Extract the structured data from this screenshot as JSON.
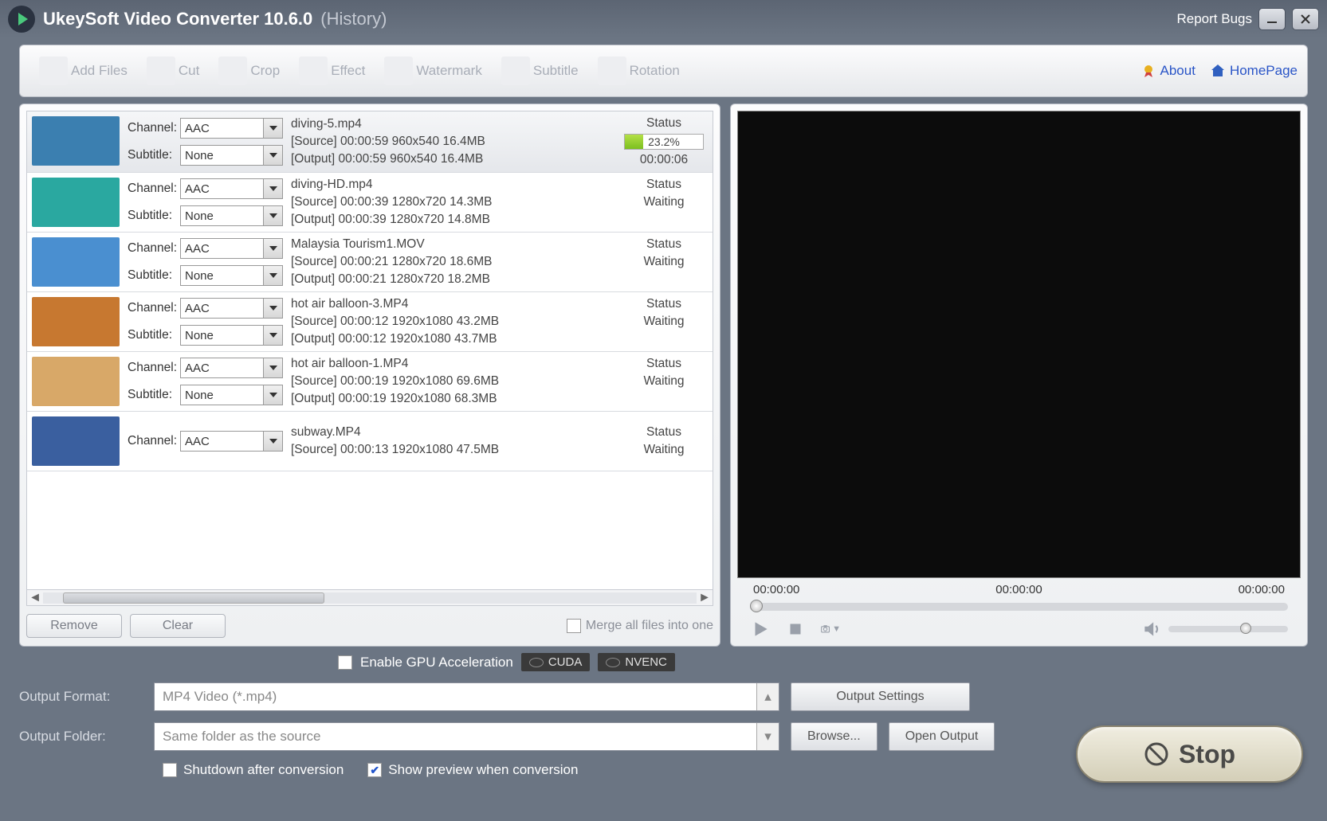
{
  "titlebar": {
    "app": "UkeySoft Video Converter 10.6.0",
    "suffix": "(History)",
    "report": "Report Bugs"
  },
  "toolbar": {
    "items": [
      "Add Files",
      "Cut",
      "Crop",
      "Effect",
      "Watermark",
      "Subtitle",
      "Rotation"
    ],
    "about": "About",
    "homepage": "HomePage"
  },
  "labels": {
    "channel": "Channel:",
    "subtitle": "Subtitle:",
    "status": "Status",
    "waiting": "Waiting"
  },
  "files": [
    {
      "name": "diving-5.mp4",
      "channel": "AAC",
      "subtitle": "None",
      "source": "[Source]  00:00:59  960x540  16.4MB",
      "output": "[Output]  00:00:59  960x540  16.4MB",
      "progress": "23.2%",
      "elapsed": "00:00:06",
      "active": true,
      "thumb": "#3b7fb0"
    },
    {
      "name": "diving-HD.mp4",
      "channel": "AAC",
      "subtitle": "None",
      "source": "[Source]  00:00:39  1280x720  14.3MB",
      "output": "[Output]  00:00:39  1280x720  14.8MB",
      "thumb": "#2aa8a0"
    },
    {
      "name": "Malaysia Tourism1.MOV",
      "channel": "AAC",
      "subtitle": "None",
      "source": "[Source]  00:00:21  1280x720  18.6MB",
      "output": "[Output]  00:00:21  1280x720  18.2MB",
      "thumb": "#4a8fd0"
    },
    {
      "name": "hot air balloon-3.MP4",
      "channel": "AAC",
      "subtitle": "None",
      "source": "[Source]  00:00:12  1920x1080  43.2MB",
      "output": "[Output]  00:00:12  1920x1080  43.7MB",
      "thumb": "#c77830"
    },
    {
      "name": "hot air balloon-1.MP4",
      "channel": "AAC",
      "subtitle": "None",
      "source": "[Source]  00:00:19  1920x1080  69.6MB",
      "output": "[Output]  00:00:19  1920x1080  68.3MB",
      "thumb": "#d8a868"
    },
    {
      "name": "subway.MP4",
      "channel": "AAC",
      "subtitle": "None",
      "source": "[Source]  00:00:13  1920x1080  47.5MB",
      "output": "",
      "thumb": "#3a5f9f",
      "partial": true
    }
  ],
  "footer": {
    "remove": "Remove",
    "clear": "Clear",
    "merge": "Merge all files into one"
  },
  "preview": {
    "t1": "00:00:00",
    "t2": "00:00:00",
    "t3": "00:00:00"
  },
  "gpu": {
    "label": "Enable GPU Acceleration",
    "cuda": "CUDA",
    "nvenc": "NVENC"
  },
  "output": {
    "formatLabel": "Output Format:",
    "formatValue": "MP4 Video (*.mp4)",
    "settings": "Output Settings",
    "folderLabel": "Output Folder:",
    "folderValue": "Same folder as the source",
    "browse": "Browse...",
    "open": "Open Output"
  },
  "options": {
    "shutdown": "Shutdown after conversion",
    "preview": "Show preview when conversion"
  },
  "stop": "Stop"
}
